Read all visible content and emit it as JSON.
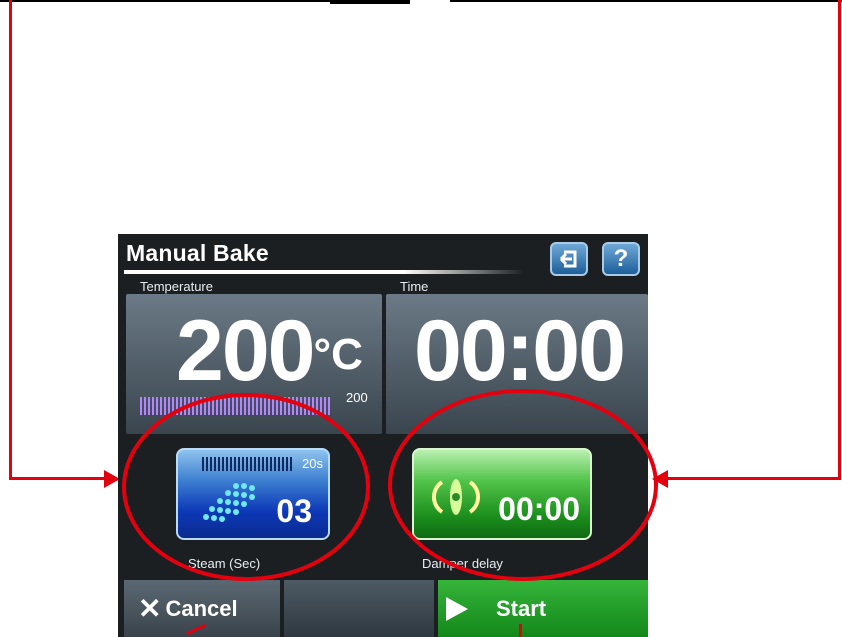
{
  "screen": {
    "title": "Manual Bake",
    "temperature_label": "Temperature",
    "time_label": "Time",
    "temperature_value": "200",
    "temperature_unit": "°C",
    "time_value": "00:00",
    "temperature_setpoint": "200",
    "temperature_bar_fraction": 1.0,
    "steam": {
      "max_label": "20s",
      "value": "03",
      "label": "Steam (Sec)",
      "bar_fraction": 1.0
    },
    "damper": {
      "value": "00:00",
      "label": "Damper delay"
    },
    "buttons": {
      "back_icon": "back-arrow-icon",
      "help_label": "?",
      "cancel_label": "Cancel",
      "start_label": "Start"
    }
  },
  "colors": {
    "annotation_red": "#e3000f",
    "steam_blue": "#0d38b7",
    "damper_green": "#1c8f1d",
    "start_green": "#1aa01f"
  }
}
